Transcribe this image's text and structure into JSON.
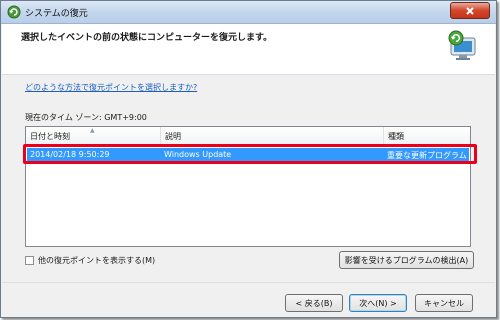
{
  "window": {
    "title": "システムの復元",
    "icon": "system-restore-icon"
  },
  "header": {
    "instruction": "選択したイベントの前の状態にコンピューターを復元します。",
    "graphic": "restore-monitor-graphic"
  },
  "help_link": "どのような方法で復元ポイントを選択しますか?",
  "timezone": "現在のタイム ゾーン: GMT+9:00",
  "list": {
    "columns": [
      "日付と時刻",
      "説明",
      "種類"
    ],
    "rows": [
      {
        "date": "2014/02/18 9:50:29",
        "description": "Windows Update",
        "type": "重要な更新プログラム",
        "selected": true
      }
    ]
  },
  "checkbox": {
    "label": "他の復元ポイントを表示する(M)",
    "checked": false
  },
  "buttons": {
    "detect": "影響を受けるプログラムの検出(A)",
    "back": "< 戻る(B)",
    "next": "次へ(N) >",
    "cancel": "キャンセル"
  },
  "colors": {
    "selection": "#3399ff",
    "highlight_border": "#e8001c",
    "link": "#1d5fbf"
  }
}
